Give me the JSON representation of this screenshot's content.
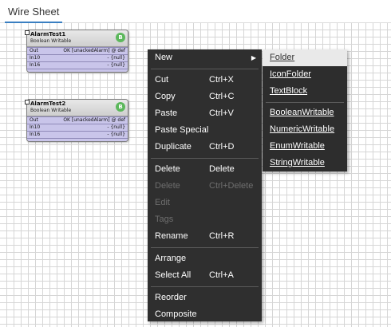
{
  "tab": {
    "label": "Wire Sheet"
  },
  "nodes": [
    {
      "title": "AlarmTest1",
      "type": "Boolean Writable",
      "badge": "B",
      "slots": [
        {
          "name": "Out",
          "value": "OK [unackedAlarm] @ def"
        },
        {
          "name": "In10",
          "value": "- {null}"
        },
        {
          "name": "In16",
          "value": "- {null}"
        }
      ]
    },
    {
      "title": "AlarmTest2",
      "type": "Boolean Writable",
      "badge": "B",
      "slots": [
        {
          "name": "Out",
          "value": "OK [unackedAlarm] @ def"
        },
        {
          "name": "In10",
          "value": "- {null}"
        },
        {
          "name": "In16",
          "value": "- {null}"
        }
      ]
    }
  ],
  "context_menu": {
    "new": {
      "label": "New",
      "arrow": "▶"
    },
    "cut": {
      "label": "Cut",
      "shortcut": "Ctrl+X"
    },
    "copy": {
      "label": "Copy",
      "shortcut": "Ctrl+C"
    },
    "paste": {
      "label": "Paste",
      "shortcut": "Ctrl+V"
    },
    "paste_special": {
      "label": "Paste Special"
    },
    "duplicate": {
      "label": "Duplicate",
      "shortcut": "Ctrl+D"
    },
    "delete": {
      "label": "Delete",
      "shortcut": "Delete"
    },
    "delete_links": {
      "label": "Delete",
      "shortcut": "Ctrl+Delete"
    },
    "edit": {
      "label": "Edit"
    },
    "tags": {
      "label": "Tags"
    },
    "rename": {
      "label": "Rename",
      "shortcut": "Ctrl+R"
    },
    "arrange": {
      "label": "Arrange"
    },
    "select_all": {
      "label": "Select All",
      "shortcut": "Ctrl+A"
    },
    "reorder": {
      "label": "Reorder"
    },
    "composite": {
      "label": "Composite"
    }
  },
  "submenu": {
    "folder": "Folder",
    "icon_folder": "IconFolder",
    "text_block": "TextBlock",
    "boolean_writable": "BooleanWritable",
    "numeric_writable": "NumericWritable",
    "enum_writable": "EnumWritable",
    "string_writable": "StringWritable"
  }
}
